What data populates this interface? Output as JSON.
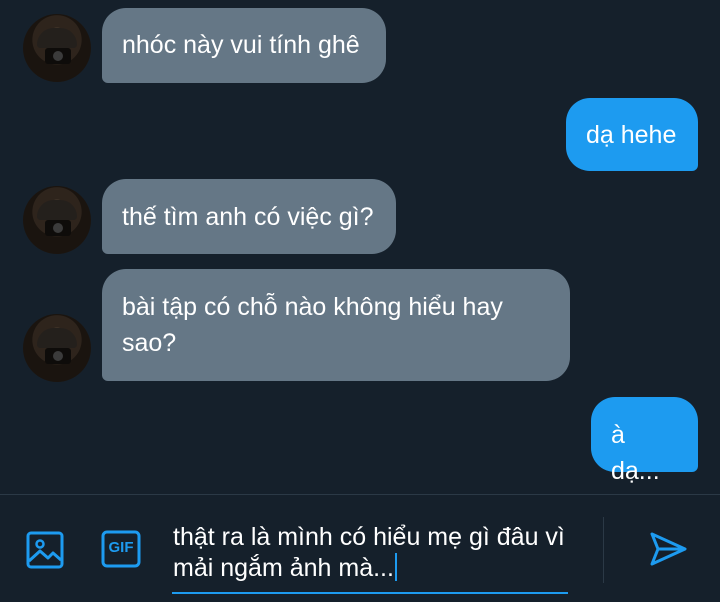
{
  "conversation": {
    "messages": [
      {
        "sender": "other",
        "text": "nhóc này vui tính ghê"
      },
      {
        "sender": "me",
        "text": "dạ hehe"
      },
      {
        "sender": "other",
        "text": "thế tìm anh có việc gì?"
      },
      {
        "sender": "other",
        "text": "bài tập có chỗ nào không hiểu hay sao?"
      },
      {
        "sender": "me",
        "text": "à dạ..."
      }
    ]
  },
  "composer": {
    "draft_text": "thật ra là mình có hiểu mẹ gì đâu vì mải ngắm ảnh mà...",
    "gif_label": "GIF"
  },
  "colors": {
    "background": "#15202b",
    "incoming_bubble": "#657786",
    "outgoing_bubble": "#1d9bf0",
    "accent": "#1d9bf0"
  }
}
